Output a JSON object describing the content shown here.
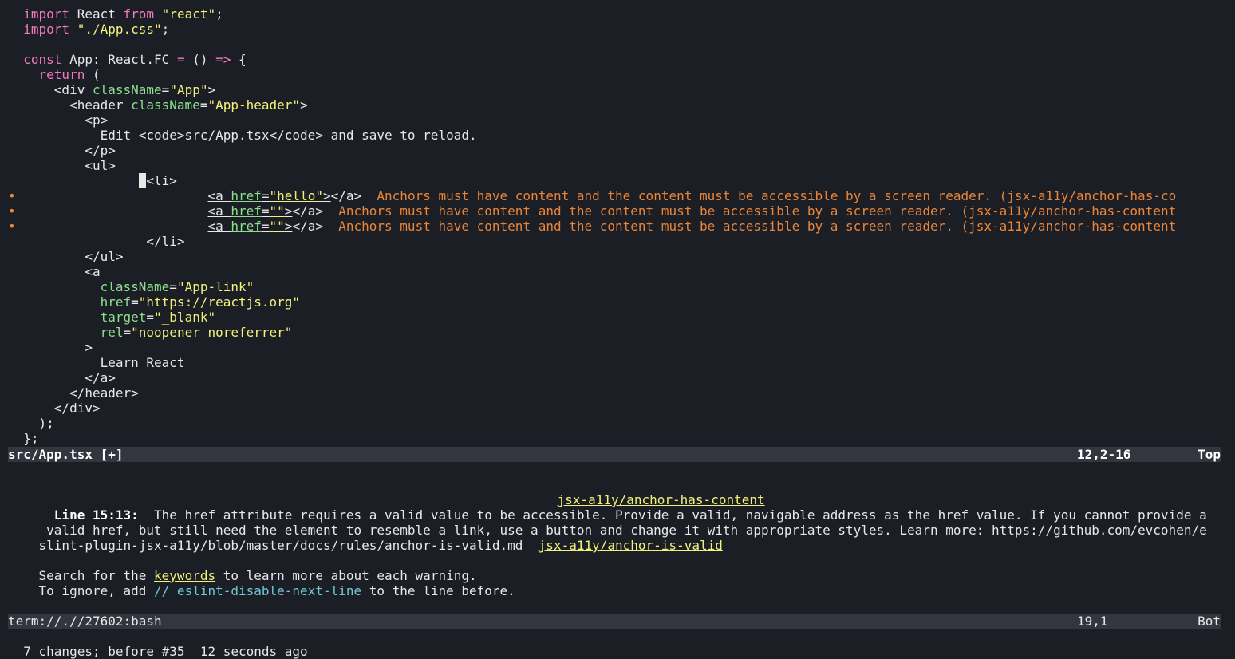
{
  "editor": {
    "lines": [
      {
        "segs": [
          [
            "kw",
            "  import"
          ],
          [
            "punc",
            " React "
          ],
          [
            "kw",
            "from"
          ],
          [
            "punc",
            " "
          ],
          [
            "str",
            "\"react\""
          ],
          [
            "punc",
            ";"
          ]
        ]
      },
      {
        "segs": [
          [
            "kw",
            "  import"
          ],
          [
            "punc",
            " "
          ],
          [
            "str",
            "\"./App.css\""
          ],
          [
            "punc",
            ";"
          ]
        ]
      },
      {
        "segs": []
      },
      {
        "segs": [
          [
            "kw",
            "  const"
          ],
          [
            "punc",
            " App: React.FC "
          ],
          [
            "op",
            "="
          ],
          [
            "punc",
            " () "
          ],
          [
            "op",
            "=>"
          ],
          [
            "punc",
            " {"
          ]
        ]
      },
      {
        "segs": [
          [
            "kw",
            "    return"
          ],
          [
            "punc",
            " ("
          ]
        ]
      },
      {
        "segs": [
          [
            "punc",
            "      <div "
          ],
          [
            "attr",
            "className"
          ],
          [
            "punc",
            "="
          ],
          [
            "str",
            "\"App\""
          ],
          [
            "punc",
            ">"
          ]
        ]
      },
      {
        "segs": [
          [
            "punc",
            "        <header "
          ],
          [
            "attr",
            "className"
          ],
          [
            "punc",
            "="
          ],
          [
            "str",
            "\"App-header\""
          ],
          [
            "punc",
            ">"
          ]
        ]
      },
      {
        "segs": [
          [
            "punc",
            "          <p>"
          ]
        ]
      },
      {
        "segs": [
          [
            "punc",
            "            Edit <code>src/App.tsx</code> and save to reload."
          ]
        ]
      },
      {
        "segs": [
          [
            "punc",
            "          </p>"
          ]
        ]
      },
      {
        "segs": [
          [
            "punc",
            "          <ul>"
          ]
        ]
      },
      {
        "segs": [
          [
            "punc",
            "                 "
          ],
          [
            "cursor",
            " "
          ],
          [
            "punc",
            "<li>"
          ]
        ]
      },
      {
        "marker": "•",
        "segs": [
          [
            "punc",
            "                          "
          ],
          [
            "punc ul",
            "<a "
          ],
          [
            "attr ul",
            "href"
          ],
          [
            "punc ul",
            "="
          ],
          [
            "str ul",
            "\"hello\""
          ],
          [
            "punc ul",
            ">"
          ],
          [
            "punc",
            "</a>  "
          ],
          [
            "diag",
            "Anchors must have content and the content must be accessible by a screen reader. (jsx-a11y/anchor-has-co"
          ]
        ]
      },
      {
        "marker": "•",
        "segs": [
          [
            "punc",
            "                          "
          ],
          [
            "punc ul",
            "<a "
          ],
          [
            "attr ul",
            "href"
          ],
          [
            "punc ul",
            "="
          ],
          [
            "str ul",
            "\"\""
          ],
          [
            "punc ul",
            ">"
          ],
          [
            "punc",
            "</a>  "
          ],
          [
            "diag",
            "Anchors must have content and the content must be accessible by a screen reader. (jsx-a11y/anchor-has-content"
          ]
        ]
      },
      {
        "marker": "•",
        "segs": [
          [
            "punc",
            "                          "
          ],
          [
            "punc ul",
            "<a "
          ],
          [
            "attr ul",
            "href"
          ],
          [
            "punc ul",
            "="
          ],
          [
            "str ul",
            "\"\""
          ],
          [
            "punc ul",
            ">"
          ],
          [
            "punc",
            "</a>  "
          ],
          [
            "diag",
            "Anchors must have content and the content must be accessible by a screen reader. (jsx-a11y/anchor-has-content"
          ]
        ]
      },
      {
        "segs": [
          [
            "punc",
            "                  </li>"
          ]
        ]
      },
      {
        "segs": [
          [
            "punc",
            "          </ul>"
          ]
        ]
      },
      {
        "segs": [
          [
            "punc",
            "          <a"
          ]
        ]
      },
      {
        "segs": [
          [
            "attr",
            "            className"
          ],
          [
            "punc",
            "="
          ],
          [
            "str",
            "\"App-link\""
          ]
        ]
      },
      {
        "segs": [
          [
            "attr",
            "            href"
          ],
          [
            "punc",
            "="
          ],
          [
            "str",
            "\"https://reactjs.org\""
          ]
        ]
      },
      {
        "segs": [
          [
            "attr",
            "            target"
          ],
          [
            "punc",
            "="
          ],
          [
            "str",
            "\"_blank\""
          ]
        ]
      },
      {
        "segs": [
          [
            "attr",
            "            rel"
          ],
          [
            "punc",
            "="
          ],
          [
            "str",
            "\"noopener noreferrer\""
          ]
        ]
      },
      {
        "segs": [
          [
            "punc",
            "          >"
          ]
        ]
      },
      {
        "segs": [
          [
            "punc",
            "            Learn React"
          ]
        ]
      },
      {
        "segs": [
          [
            "punc",
            "          </a>"
          ]
        ]
      },
      {
        "segs": [
          [
            "punc",
            "        </header>"
          ]
        ]
      },
      {
        "segs": [
          [
            "punc",
            "      </div>"
          ]
        ]
      },
      {
        "segs": [
          [
            "punc",
            "    );"
          ]
        ]
      },
      {
        "segs": [
          [
            "punc",
            "  };"
          ]
        ]
      }
    ]
  },
  "statusline_top": {
    "filename": "src/App.tsx [+]",
    "position": "12,2-16",
    "scroll": "Top"
  },
  "terminal": {
    "rule_heading": "jsx-a11y/anchor-has-content",
    "line_label": "Line 15:13:",
    "message_1": "  The href attribute requires a valid value to be accessible. Provide a valid, navigable address as the href value. If you cannot provide a",
    "message_2": " valid href, but still need the element to resemble a link, use a button and change it with appropriate styles. Learn more: https://github.com/evcohen/e",
    "message_3": "slint-plugin-jsx-a11y/blob/master/docs/rules/anchor-is-valid.md  ",
    "rule_link": "jsx-a11y/anchor-is-valid",
    "search_prefix": "Search for the ",
    "search_keyword": "keywords",
    "search_suffix": " to learn more about each warning.",
    "ignore_prefix": "To ignore, add ",
    "ignore_code": "// eslint-disable-next-line",
    "ignore_suffix": " to the line before."
  },
  "statusline_bottom": {
    "filename": "term://.//27602:bash",
    "position": "19,1",
    "scroll": "Bot"
  },
  "command_line": {
    "message": "7 changes; before #35  12 seconds ago"
  },
  "colors": {
    "background": "#1c1e26",
    "statusline": "#33363f",
    "keyword": "#f07ac0",
    "string": "#f2f27a",
    "attribute": "#8ce08c",
    "diagnostic": "#e98538",
    "comment_cyan": "#6fc8d8"
  }
}
